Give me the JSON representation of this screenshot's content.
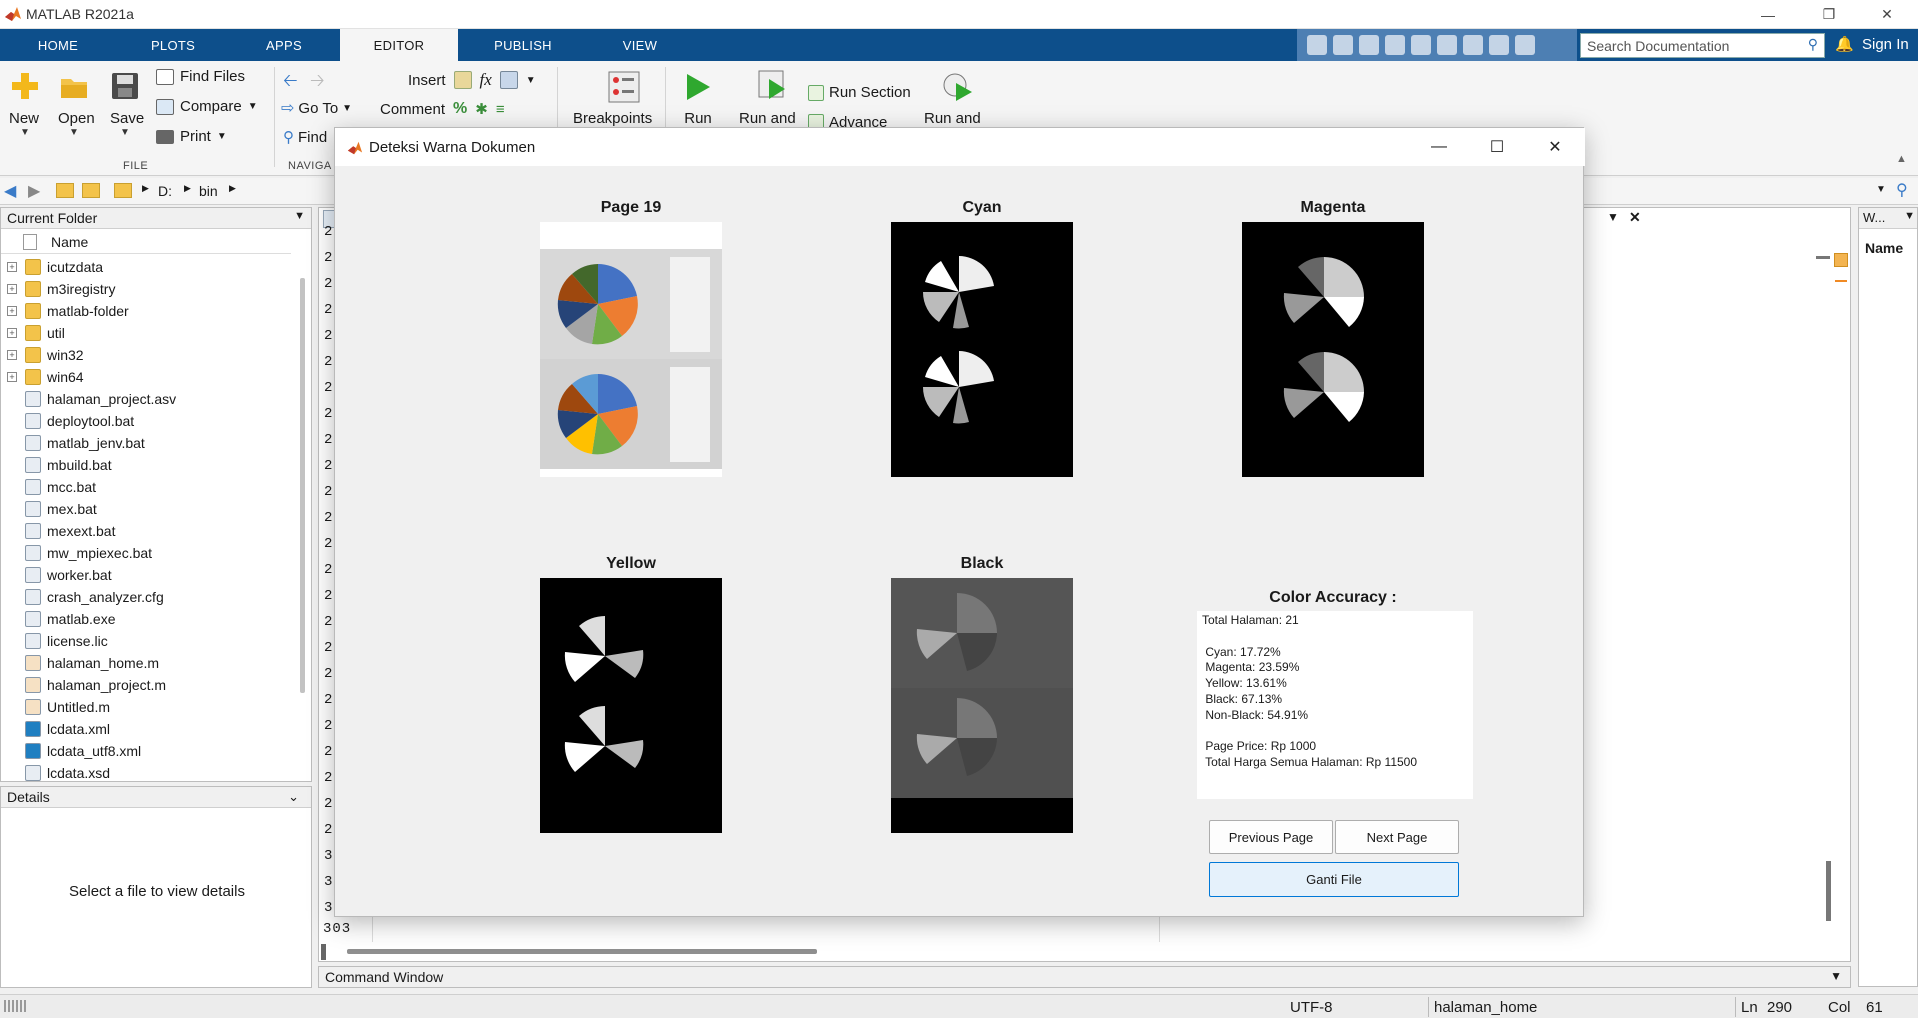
{
  "app": {
    "title": "MATLAB R2021a"
  },
  "tabs": [
    "HOME",
    "PLOTS",
    "APPS",
    "EDITOR",
    "PUBLISH",
    "VIEW"
  ],
  "search": {
    "placeholder": "Search Documentation"
  },
  "signin": "Sign In",
  "ribbon": {
    "new": "New",
    "open": "Open",
    "save": "Save",
    "find_files": "Find Files",
    "compare": "Compare",
    "print": "Print",
    "file_group": "FILE",
    "goto": "Go To",
    "find": "Find",
    "navigate_group": "NAVIGA",
    "insert": "Insert",
    "comment": "Comment",
    "breakpoints": "Breakpoints",
    "run": "Run",
    "run_and_advance": "Run and",
    "run_section": "Run Section",
    "advance": "Advance",
    "run_and_time": "Run and"
  },
  "address": {
    "drive": "D:",
    "folder": "bin"
  },
  "current_folder": {
    "title": "Current Folder",
    "column": "Name",
    "items": [
      {
        "name": "icutzdata",
        "type": "folder"
      },
      {
        "name": "m3iregistry",
        "type": "folder"
      },
      {
        "name": "matlab-folder",
        "type": "folder"
      },
      {
        "name": "util",
        "type": "folder"
      },
      {
        "name": "win32",
        "type": "folder"
      },
      {
        "name": "win64",
        "type": "folder"
      },
      {
        "name": "halaman_project.asv",
        "type": "file"
      },
      {
        "name": "deploytool.bat",
        "type": "file"
      },
      {
        "name": "matlab_jenv.bat",
        "type": "file"
      },
      {
        "name": "mbuild.bat",
        "type": "file"
      },
      {
        "name": "mcc.bat",
        "type": "file"
      },
      {
        "name": "mex.bat",
        "type": "file"
      },
      {
        "name": "mexext.bat",
        "type": "file"
      },
      {
        "name": "mw_mpiexec.bat",
        "type": "file"
      },
      {
        "name": "worker.bat",
        "type": "file"
      },
      {
        "name": "crash_analyzer.cfg",
        "type": "file"
      },
      {
        "name": "matlab.exe",
        "type": "file"
      },
      {
        "name": "license.lic",
        "type": "file"
      },
      {
        "name": "halaman_home.m",
        "type": "file"
      },
      {
        "name": "halaman_project.m",
        "type": "file"
      },
      {
        "name": "Untitled.m",
        "type": "file"
      },
      {
        "name": "lcdata.xml",
        "type": "file"
      },
      {
        "name": "lcdata_utf8.xml",
        "type": "file"
      },
      {
        "name": "lcdata.xsd",
        "type": "file"
      }
    ]
  },
  "details": {
    "title": "Details",
    "message": "Select a file to view details"
  },
  "editor": {
    "line_number": "303",
    "gutter_digit": "2",
    "gutter_digit_last": "3"
  },
  "right_panel": {
    "title": "W...",
    "column": "Name"
  },
  "command_window": {
    "title": "Command Window"
  },
  "status": {
    "encoding": "UTF-8",
    "file": "halaman_home",
    "ln_label": "Ln",
    "ln": "290",
    "col_label": "Col",
    "col": "61"
  },
  "dialog": {
    "title": "Deteksi Warna Dokumen",
    "images": [
      {
        "label": "Page 19"
      },
      {
        "label": "Cyan"
      },
      {
        "label": "Magenta"
      },
      {
        "label": "Yellow"
      },
      {
        "label": "Black"
      }
    ],
    "accuracy_title": "Color Accuracy :",
    "accuracy_text": "Total Halaman: 21\n\n Cyan: 17.72%\n Magenta: 23.59%\n Yellow: 13.61%\n Black: 67.13%\n Non-Black: 54.91%\n\n Page Price: Rp 1000\n Total Harga Semua Halaman: Rp 11500",
    "prev_button": "Previous Page",
    "next_button": "Next Page",
    "change_file_button": "Ganti File"
  },
  "colors": {
    "tabstrip": "#0d4f8b",
    "accent": "#e87722",
    "dialog_bg": "#f0f0f0"
  }
}
